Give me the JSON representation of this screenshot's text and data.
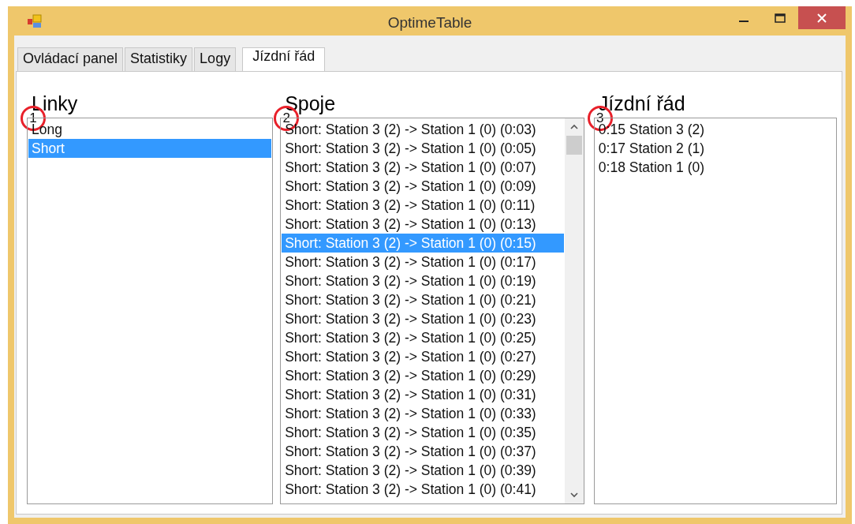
{
  "window": {
    "title": "OptimeTable"
  },
  "tabs": [
    {
      "label": "Ovládací panel",
      "selected": false
    },
    {
      "label": "Statistiky",
      "selected": false
    },
    {
      "label": "Logy",
      "selected": false
    },
    {
      "label": "Jízdní řád",
      "selected": true
    }
  ],
  "panels": [
    {
      "heading": "Linky",
      "callout": "1",
      "scrollbar": false,
      "items": [
        {
          "text": "Long",
          "selected": false
        },
        {
          "text": "Short",
          "selected": true
        }
      ]
    },
    {
      "heading": "Spoje",
      "callout": "2",
      "scrollbar": true,
      "items": [
        {
          "text": "Short: Station 3 (2) -> Station 1 (0) (0:03)",
          "selected": false
        },
        {
          "text": "Short: Station 3 (2) -> Station 1 (0) (0:05)",
          "selected": false
        },
        {
          "text": "Short: Station 3 (2) -> Station 1 (0) (0:07)",
          "selected": false
        },
        {
          "text": "Short: Station 3 (2) -> Station 1 (0) (0:09)",
          "selected": false
        },
        {
          "text": "Short: Station 3 (2) -> Station 1 (0) (0:11)",
          "selected": false
        },
        {
          "text": "Short: Station 3 (2) -> Station 1 (0) (0:13)",
          "selected": false
        },
        {
          "text": "Short: Station 3 (2) -> Station 1 (0) (0:15)",
          "selected": true
        },
        {
          "text": "Short: Station 3 (2) -> Station 1 (0) (0:17)",
          "selected": false
        },
        {
          "text": "Short: Station 3 (2) -> Station 1 (0) (0:19)",
          "selected": false
        },
        {
          "text": "Short: Station 3 (2) -> Station 1 (0) (0:21)",
          "selected": false
        },
        {
          "text": "Short: Station 3 (2) -> Station 1 (0) (0:23)",
          "selected": false
        },
        {
          "text": "Short: Station 3 (2) -> Station 1 (0) (0:25)",
          "selected": false
        },
        {
          "text": "Short: Station 3 (2) -> Station 1 (0) (0:27)",
          "selected": false
        },
        {
          "text": "Short: Station 3 (2) -> Station 1 (0) (0:29)",
          "selected": false
        },
        {
          "text": "Short: Station 3 (2) -> Station 1 (0) (0:31)",
          "selected": false
        },
        {
          "text": "Short: Station 3 (2) -> Station 1 (0) (0:33)",
          "selected": false
        },
        {
          "text": "Short: Station 3 (2) -> Station 1 (0) (0:35)",
          "selected": false
        },
        {
          "text": "Short: Station 3 (2) -> Station 1 (0) (0:37)",
          "selected": false
        },
        {
          "text": "Short: Station 3 (2) -> Station 1 (0) (0:39)",
          "selected": false
        },
        {
          "text": "Short: Station 3 (2) -> Station 1 (0) (0:41)",
          "selected": false
        }
      ]
    },
    {
      "heading": "Jízdní řád",
      "callout": "3",
      "scrollbar": false,
      "items": [
        {
          "text": "0:15 Station 3 (2)",
          "selected": false
        },
        {
          "text": "0:17 Station 2 (1)",
          "selected": false
        },
        {
          "text": "0:18 Station 1 (0)",
          "selected": false
        }
      ]
    }
  ]
}
